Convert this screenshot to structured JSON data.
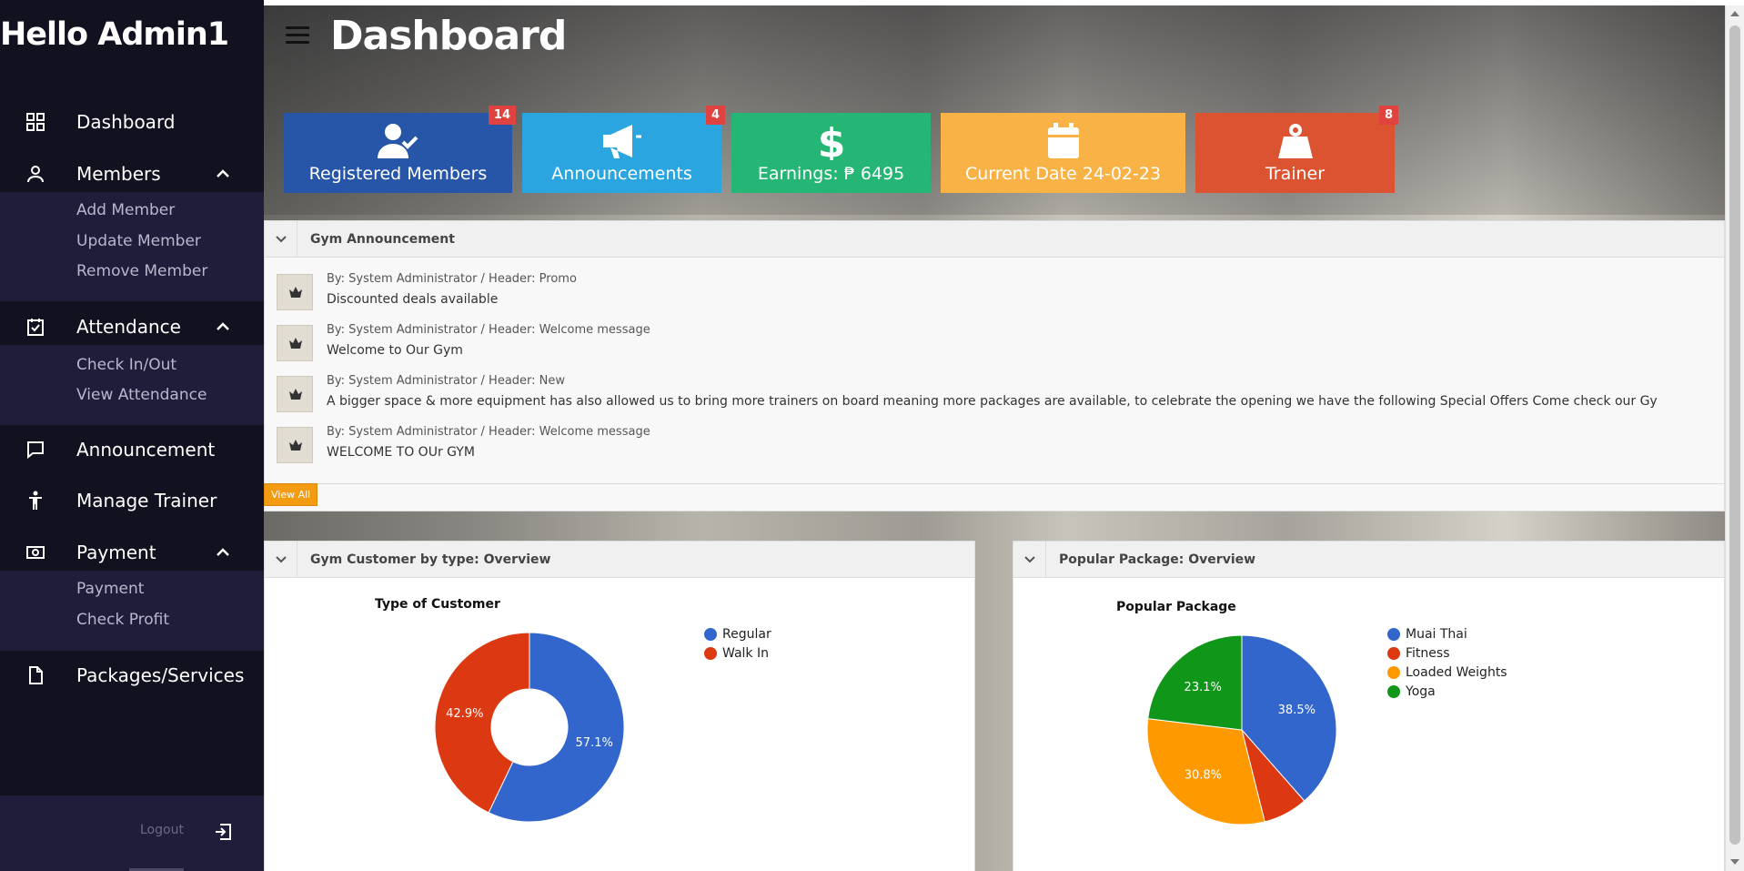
{
  "sidebar": {
    "greeting": "Hello Admin1",
    "items": [
      {
        "label": "Dashboard",
        "icon": "grid-icon"
      },
      {
        "label": "Members",
        "icon": "user-icon",
        "expanded": true,
        "children": [
          "Add Member",
          "Update Member",
          "Remove Member"
        ]
      },
      {
        "label": "Attendance",
        "icon": "calendar-check-icon",
        "expanded": true,
        "children": [
          "Check In/Out",
          "View Attendance"
        ]
      },
      {
        "label": "Announcement",
        "icon": "chat-bubble-icon"
      },
      {
        "label": "Manage Trainer",
        "icon": "person-icon"
      },
      {
        "label": "Payment",
        "icon": "cash-icon",
        "expanded": true,
        "children": [
          "Payment",
          "Check Profit"
        ]
      },
      {
        "label": "Packages/Services",
        "icon": "document-icon"
      }
    ],
    "logout_label": "Logout"
  },
  "header": {
    "title": "Dashboard"
  },
  "tiles": [
    {
      "label": "Registered Members",
      "badge": "14",
      "color": "#2755a8",
      "icon": "user-check-icon"
    },
    {
      "label": "Announcements",
      "badge": "4",
      "color": "#2aa5e0",
      "icon": "megaphone-icon"
    },
    {
      "label": "Earnings: ₱ 6495",
      "badge": "",
      "color": "#25b574",
      "icon": "dollar-icon"
    },
    {
      "label": "Current Date 24-02-23",
      "badge": "",
      "color": "#f8b245",
      "icon": "calendar-icon"
    },
    {
      "label": "Trainer",
      "badge": "8",
      "color": "#dc5331",
      "icon": "weight-icon"
    }
  ],
  "announcements": {
    "title": "Gym Announcement",
    "items": [
      {
        "meta": "By: System Administrator / Header: Promo",
        "message": "Discounted deals available"
      },
      {
        "meta": "By: System Administrator / Header: Welcome message",
        "message": "Welcome to Our Gym"
      },
      {
        "meta": "By: System Administrator / Header: New",
        "message": "A bigger space & more equipment has also allowed us to bring more trainers on board meaning more packages are available, to celebrate the opening we have the following Special Offers Come check our Gy"
      },
      {
        "meta": "By: System Administrator / Header: Welcome message",
        "message": "WELCOME TO OUr GYM"
      }
    ],
    "view_all_label": "View All"
  },
  "customer_panel": {
    "title": "Gym Customer by type: Overview"
  },
  "package_panel": {
    "title": "Popular Package: Overview"
  },
  "chart_data": [
    {
      "type": "pie",
      "donut": true,
      "title": "Type of Customer",
      "categories": [
        "Regular",
        "Walk In"
      ],
      "values": [
        57.1,
        42.9
      ],
      "labels": [
        "57.1%",
        "42.9%"
      ],
      "colors": [
        "#3366cc",
        "#dc3912"
      ],
      "legend": "right"
    },
    {
      "type": "pie",
      "donut": false,
      "title": "Popular Package",
      "categories": [
        "Muai Thai",
        "Fitness",
        "Loaded Weights",
        "Yoga"
      ],
      "values": [
        38.5,
        7.6,
        30.8,
        23.1
      ],
      "labels": [
        "38.5%",
        "",
        "30.8%",
        "23.1%"
      ],
      "colors": [
        "#3366cc",
        "#dc3912",
        "#ff9900",
        "#109618"
      ],
      "legend": "right"
    }
  ]
}
